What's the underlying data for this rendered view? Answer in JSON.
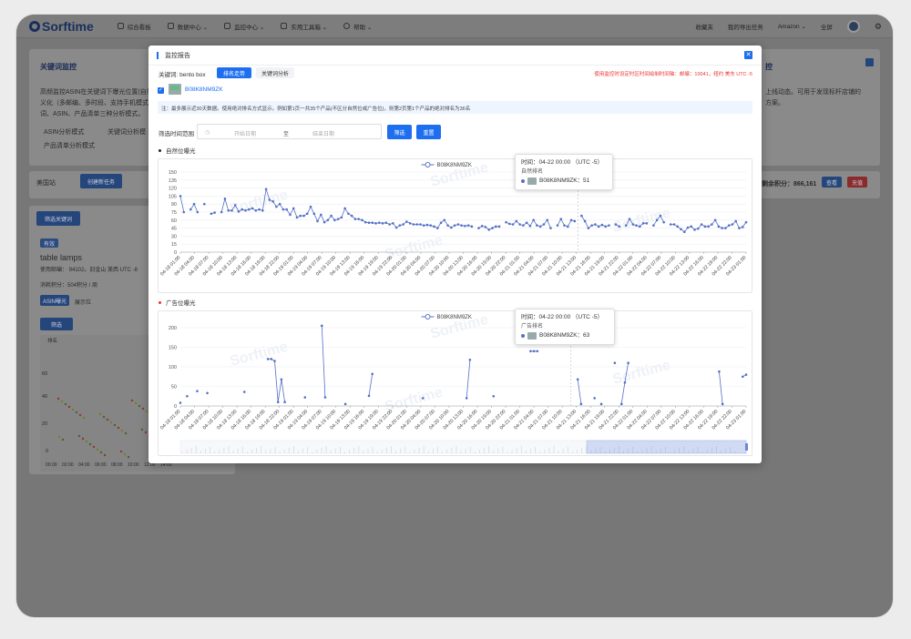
{
  "topbar": {
    "brand": "Sorftime",
    "nav": [
      {
        "label": "综合看板",
        "icon": "home-icon"
      },
      {
        "label": "数据中心 ⌄",
        "icon": "database-icon"
      },
      {
        "label": "监控中心 ⌄",
        "icon": "monitor-icon"
      },
      {
        "label": "实用工具箱 ⌄",
        "icon": "toolbox-icon"
      },
      {
        "label": "帮助 ⌄",
        "icon": "help-icon"
      }
    ],
    "right": {
      "favorites": "收藏夹",
      "export": "我的导出任务",
      "market": "Amazon ⌄",
      "fullscreen": "全屏"
    }
  },
  "background": {
    "panel_title": "关键词监控",
    "desc1": "高频监控ASIN在关键词下曝光位置(自然位、",
    "desc2": "义化（多邮编、多时段、支持手机模式）",
    "desc3": "词、ASIN、产品清单三种分析模式。",
    "mode1": "ASIN分析模式",
    "mode2": "关键词分析模",
    "mode3": "产品清单分析模式",
    "right_title": "控",
    "right_desc1": "上线动态。可用于发现标杆店铺的",
    "right_desc2": "方案。",
    "site": "美国站",
    "create_task": "创建新任务",
    "credits": "剩余积分：866,161",
    "btn_view": "查看",
    "btn_recharge": "充值",
    "filter_kw": "筛选关键词",
    "status_tag": "有效",
    "task_name": "table lamps",
    "zipcode": "使用邮编： 94102。旧金山 美西 UTC -8",
    "consume": "消耗积分：504积分 / 周",
    "tab_asin": "ASIN曝光",
    "tab_show": "展示位",
    "filter_btn": "筛选",
    "rank_label": "排名",
    "yticks": [
      "60",
      "40",
      "20",
      "0"
    ],
    "xticks": [
      "00:00",
      "02:00",
      "04:00",
      "06:00",
      "08:00",
      "10:00",
      "12:00",
      "14:00"
    ]
  },
  "modal": {
    "title": "监控报告",
    "keyword": "关键词: bento box",
    "tab_rank": "排名走势",
    "tab_kw": "关键词分析",
    "timezone_notice": "使用监控时设定时区时间绘制时间轴：邮编：10041，纽约 美东 UTC -5",
    "asin": "B08K8NM9ZK",
    "note": "注：最多展示近30天数据。使用绝对排名方式显示。例如第1页一共35个产品(不区分自然位或广告位)，则第2页第1个产品的绝对排名为36名",
    "filter_label": "筛选时间范围",
    "start_placeholder": "开始日期",
    "range_sep": "至",
    "end_placeholder": "结束日期",
    "btn_filter": "筛选",
    "btn_reset": "重置",
    "section1": "自然位曝光",
    "section2": "广告位曝光",
    "watermark": "Sorftime"
  },
  "colors": {
    "accent": "#1d6ff0",
    "series": "#5470c6",
    "notice": "#ee3333",
    "ad_dot": "#e33333"
  },
  "chart_data": [
    {
      "type": "line",
      "title": "自然位曝光",
      "legend": "B08K8NM9ZK",
      "series": [
        {
          "name": "B08K8NM9ZK",
          "values": [
            105,
            75,
            null,
            80,
            90,
            75,
            null,
            90,
            null,
            72,
            74,
            null,
            75,
            100,
            78,
            78,
            88,
            76,
            80,
            78,
            80,
            82,
            78,
            80,
            78,
            118,
            98,
            95,
            85,
            90,
            80,
            80,
            70,
            82,
            65,
            68,
            68,
            72,
            85,
            72,
            58,
            70,
            56,
            60,
            68,
            60,
            62,
            65,
            82,
            72,
            68,
            62,
            62,
            60,
            56,
            55,
            55,
            54,
            55,
            54,
            55,
            52,
            54,
            46,
            50,
            52,
            57,
            54,
            52,
            52,
            52,
            50,
            51,
            50,
            48,
            45,
            55,
            60,
            50,
            46,
            50,
            52,
            50,
            49,
            50,
            48,
            null,
            45,
            49,
            47,
            42,
            45,
            48,
            48,
            null,
            56,
            53,
            52,
            58,
            52,
            50,
            55,
            49,
            60,
            50,
            48,
            52,
            60,
            45,
            null,
            50,
            62,
            50,
            48,
            60,
            58,
            null,
            68,
            58,
            45,
            50,
            52,
            48,
            51,
            48,
            50,
            null,
            52,
            48,
            null,
            50,
            62,
            52,
            50,
            48,
            54,
            54,
            null,
            50,
            60,
            68,
            56,
            null,
            52,
            52,
            48,
            43,
            38,
            46,
            48,
            42,
            44,
            52,
            48,
            48,
            52,
            60,
            48,
            45,
            45,
            50,
            52,
            58,
            45,
            47,
            56
          ]
        }
      ],
      "x_start": "04-18 01:00",
      "x_step_hours": 3,
      "xticks": [
        "04-18 01:00",
        "04-18 04:00",
        "04-18 07:00",
        "04-18 10:00",
        "04-18 13:00",
        "04-18 16:00",
        "04-18 19:00",
        "04-18 22:00",
        "04-19 01:00",
        "04-19 04:00",
        "04-19 07:00",
        "04-19 10:00",
        "04-19 13:00",
        "04-19 16:00",
        "04-19 19:00",
        "04-19 22:00",
        "04-20 01:00",
        "04-20 04:00",
        "04-20 07:00",
        "04-20 10:00",
        "04-20 13:00",
        "04-20 16:00",
        "04-20 19:00",
        "04-20 22:00",
        "04-21 01:00",
        "04-21 04:00",
        "04-21 07:00",
        "04-21 10:00",
        "04-21 13:00",
        "04-21 16:00",
        "04-21 19:00",
        "04-21 22:00",
        "04-22 01:00",
        "04-22 04:00",
        "04-22 07:00",
        "04-22 10:00",
        "04-22 13:00",
        "04-22 16:00",
        "04-22 19:00",
        "04-22 22:00",
        "04-23 01:00"
      ],
      "ylim": [
        0,
        150
      ],
      "yticks": [
        0,
        15,
        30,
        45,
        60,
        75,
        90,
        105,
        120,
        135,
        150
      ],
      "tooltip": {
        "time": "时间：04-22 00:00 （UTC -5）",
        "label": "自然排名",
        "value_text": "B08K8NM9ZK：51"
      }
    },
    {
      "type": "line",
      "title": "广告位曝光",
      "legend": "B08K8NM9ZK",
      "series": [
        {
          "name": "B08K8NM9ZK",
          "values": [
            8,
            null,
            25,
            null,
            null,
            38,
            null,
            null,
            33,
            null,
            null,
            null,
            null,
            null,
            null,
            null,
            null,
            null,
            null,
            36,
            null,
            null,
            null,
            null,
            null,
            null,
            120,
            120,
            115,
            10,
            68,
            10,
            null,
            null,
            null,
            null,
            null,
            22,
            null,
            null,
            null,
            null,
            205,
            22,
            null,
            null,
            null,
            null,
            null,
            5,
            null,
            null,
            null,
            null,
            null,
            null,
            26,
            82,
            null,
            null,
            null,
            null,
            null,
            null,
            null,
            null,
            null,
            null,
            null,
            null,
            null,
            null,
            20,
            null,
            null,
            null,
            null,
            null,
            null,
            null,
            null,
            null,
            null,
            null,
            null,
            20,
            118,
            null,
            null,
            null,
            null,
            null,
            null,
            25,
            null,
            null,
            null,
            null,
            null,
            null,
            null,
            null,
            null,
            null,
            140,
            140,
            140,
            null,
            null,
            null,
            null,
            null,
            null,
            null,
            null,
            null,
            null,
            null,
            68,
            5,
            null,
            null,
            null,
            20,
            null,
            5,
            null,
            null,
            null,
            110,
            null,
            5,
            60,
            110,
            null,
            null,
            null,
            null,
            null,
            null,
            null,
            null,
            null,
            null,
            null,
            null,
            null,
            null,
            null,
            null,
            null,
            null,
            null,
            null,
            null,
            null,
            null,
            null,
            null,
            null,
            88,
            5,
            null,
            null,
            null,
            null,
            null,
            75,
            80
          ]
        }
      ],
      "x_start": "04-18 01:00",
      "x_step_hours": 3,
      "xticks": [
        "04-18 01:00",
        "04-18 04:00",
        "04-18 07:00",
        "04-18 10:00",
        "04-18 13:00",
        "04-18 16:00",
        "04-18 19:00",
        "04-18 22:00",
        "04-19 01:00",
        "04-19 04:00",
        "04-19 07:00",
        "04-19 10:00",
        "04-19 13:00",
        "04-19 16:00",
        "04-19 19:00",
        "04-19 22:00",
        "04-20 01:00",
        "04-20 04:00",
        "04-20 07:00",
        "04-20 10:00",
        "04-20 13:00",
        "04-20 16:00",
        "04-20 19:00",
        "04-20 22:00",
        "04-21 01:00",
        "04-21 04:00",
        "04-21 07:00",
        "04-21 10:00",
        "04-21 13:00",
        "04-21 16:00",
        "04-21 19:00",
        "04-21 22:00",
        "04-22 01:00",
        "04-22 04:00",
        "04-22 07:00",
        "04-22 10:00",
        "04-22 13:00",
        "04-22 16:00",
        "04-22 19:00",
        "04-22 22:00",
        "04-23 01:00"
      ],
      "ylim": [
        0,
        200
      ],
      "yticks": [
        0,
        50,
        100,
        150,
        200
      ],
      "tooltip": {
        "time": "时间：04-22 00:00 （UTC -5）",
        "label": "广告排名",
        "value_text": "B08K8NM9ZK：63"
      }
    }
  ]
}
